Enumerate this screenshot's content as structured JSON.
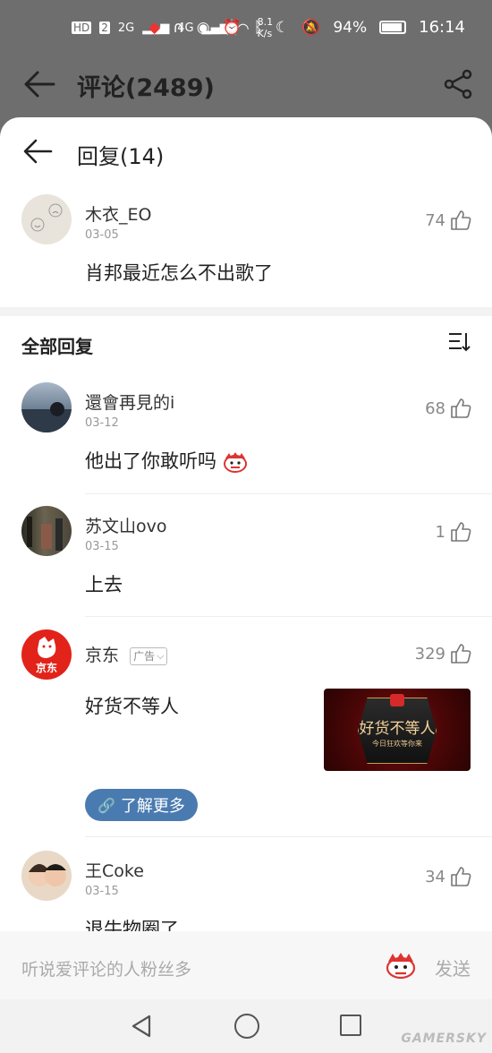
{
  "status_bar": {
    "hd_label": "HD",
    "sim2": "2",
    "net1": "2G",
    "net2": "4G",
    "speed_value": "8.1",
    "speed_unit": "K/s",
    "battery": "94%",
    "time": "16:14"
  },
  "header": {
    "title": "评论(2489)"
  },
  "sheet": {
    "title": "回复(14)"
  },
  "parent_comment": {
    "user": "木衣_EO",
    "date": "03-05",
    "text": "肖邦最近怎么不出歌了",
    "likes": "74"
  },
  "section": {
    "title": "全部回复"
  },
  "replies": [
    {
      "user": "還會再見的i",
      "date": "03-12",
      "text": "他出了你敢听吗",
      "likes": "68"
    },
    {
      "user": "苏文山ovo",
      "date": "03-15",
      "text": "上去",
      "likes": "1"
    },
    {
      "user": "京东",
      "ad_tag": "广告",
      "text": "好货不等人",
      "likes": "329",
      "ad_image_text": "好货不等人",
      "ad_image_sub": "今日狂欢等你来",
      "button": "了解更多"
    },
    {
      "user": "王Coke",
      "date": "03-15",
      "text": "退牛物圈了",
      "likes": "34"
    }
  ],
  "input_bar": {
    "placeholder": "听说爱评论的人粉丝多",
    "send": "发送"
  },
  "watermark": "GAMERSKY",
  "colors": {
    "accent_button": "#4a7bb0",
    "jd_red": "#e2231a"
  }
}
